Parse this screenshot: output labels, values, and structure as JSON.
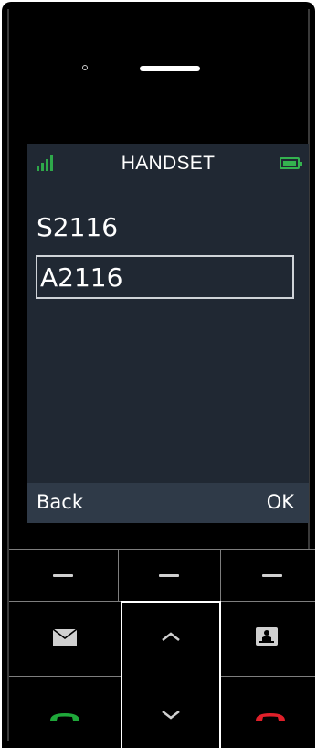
{
  "status_bar": {
    "title": "HANDSET",
    "signal_icon": "signal-bars-icon",
    "battery_icon": "battery-icon",
    "signal_color": "#2ea84a",
    "battery_color": "#34b34f"
  },
  "menu": {
    "items": [
      {
        "label": "S2116",
        "selected": false
      },
      {
        "label": "A2116",
        "selected": true
      }
    ]
  },
  "softkeys": {
    "left_label": "Back",
    "right_label": "OK"
  },
  "keys": {
    "soft_left_icon": "dash-icon",
    "soft_center_icon": "dash-icon",
    "soft_right_icon": "dash-icon",
    "message_icon": "envelope-icon",
    "up_icon": "chevron-up-icon",
    "down_icon": "chevron-down-icon",
    "phonebook_icon": "phonebook-icon",
    "call_icon": "green-handset-icon",
    "end_icon": "red-handset-icon",
    "call_color": "#1fa83a",
    "end_color": "#e0202a"
  },
  "colors": {
    "screen_bg": "#202833",
    "softbar_bg": "#2f3a48"
  }
}
